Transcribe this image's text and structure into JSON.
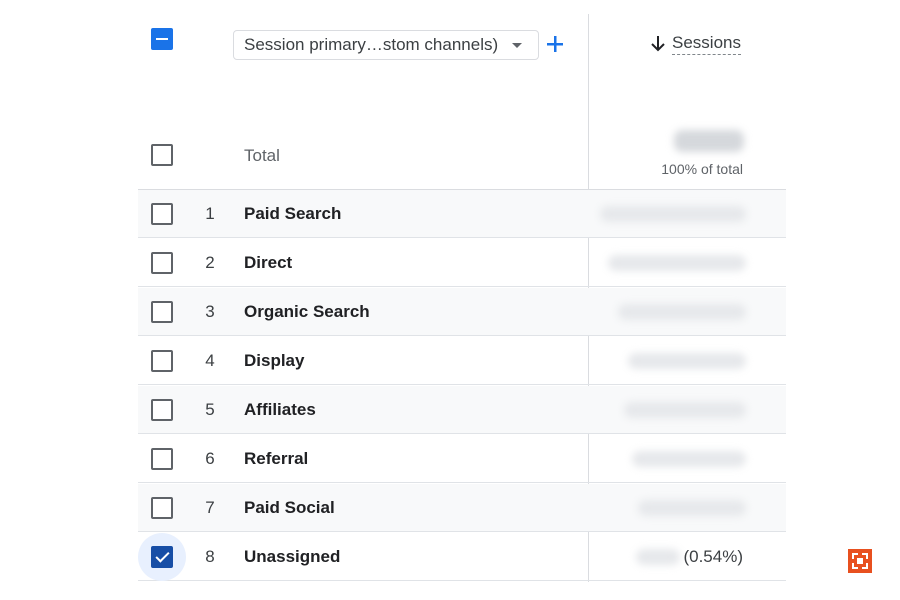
{
  "header": {
    "dimension_select": "Session primary…stom channels)",
    "metric_label": "Sessions",
    "sort_icon": "arrow-down-icon",
    "add_icon": "plus-icon"
  },
  "total": {
    "label": "Total",
    "percent": "100% of total"
  },
  "rows": [
    {
      "index": "1",
      "name": "Paid Search",
      "checked": false
    },
    {
      "index": "2",
      "name": "Direct",
      "checked": false
    },
    {
      "index": "3",
      "name": "Organic Search",
      "checked": false
    },
    {
      "index": "4",
      "name": "Display",
      "checked": false
    },
    {
      "index": "5",
      "name": "Affiliates",
      "checked": false
    },
    {
      "index": "6",
      "name": "Referral",
      "checked": false
    },
    {
      "index": "7",
      "name": "Paid Social",
      "checked": false
    },
    {
      "index": "8",
      "name": "Unassigned",
      "checked": true,
      "percent": "(0.54%)"
    }
  ],
  "colors": {
    "accent": "#1a73e8",
    "checked": "#174ea6"
  },
  "brand_icon": "brand-logo-icon"
}
